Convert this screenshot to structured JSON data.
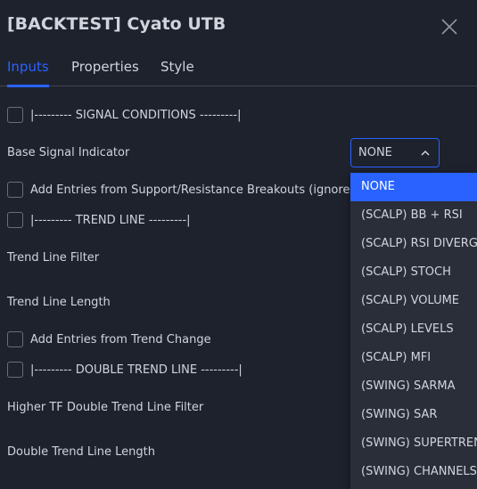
{
  "dialog": {
    "title": "[BACKTEST] Cyato UTB",
    "close_icon": "close-icon"
  },
  "tabs": [
    {
      "label": "Inputs",
      "active": true
    },
    {
      "label": "Properties",
      "active": false
    },
    {
      "label": "Style",
      "active": false
    }
  ],
  "inputs": {
    "signal_conditions_header": "|--------- SIGNAL CONDITIONS ---------|",
    "base_signal_label": "Base Signal Indicator",
    "base_signal_value": "NONE",
    "sr_breakouts_label": "Add Entries from Support/Resistance Breakouts (ignores t",
    "trend_line_header": "|--------- TREND LINE ---------|",
    "trend_line_filter_label": "Trend Line Filter",
    "trend_line_length_label": "Trend Line Length",
    "trend_change_label": "Add Entries from Trend Change",
    "double_trend_header": "|--------- DOUBLE TREND LINE ---------|",
    "higher_tf_filter_label": "Higher TF Double Trend Line Filter",
    "double_trend_length_label": "Double Trend Line Length"
  },
  "dropdown": {
    "options": [
      "NONE",
      "(SCALP) BB + RSI",
      "(SCALP) RSI DIVERGE",
      "(SCALP) STOCH",
      "(SCALP) VOLUME",
      "(SCALP) LEVELS",
      "(SCALP) MFI",
      "(SWING) SARMA",
      "(SWING) SAR",
      "(SWING) SUPERTRENI",
      "(SWING) CHANNELS"
    ],
    "selected": "NONE"
  },
  "colors": {
    "background": "#1e222d",
    "accent": "#2962ff",
    "text": "#d1d4dc",
    "dropdown_bg": "#2a2e39"
  }
}
